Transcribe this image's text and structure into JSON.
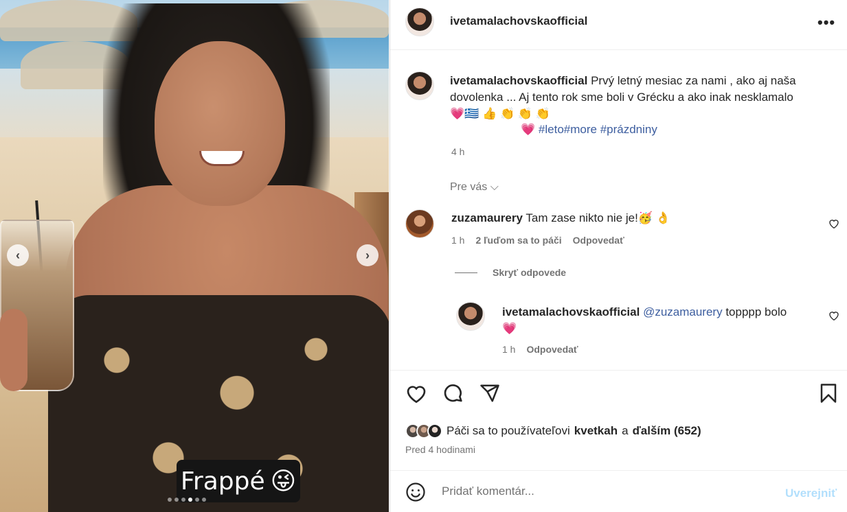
{
  "media": {
    "sticker_text": "Frappé",
    "sticker_emoji": "😜",
    "prev_label": "‹",
    "next_label": "›",
    "slide_count": 6,
    "active_slide": 4
  },
  "header": {
    "username": "ivetamalachovskaofficial",
    "more_label": "•••"
  },
  "caption": {
    "username": "ivetamalachovskaofficial",
    "text": "Prvý letný mesiac za nami , ako aj naša dovolenka ... Aj tento rok sme boli v Grécku a ako inak nesklamalo",
    "emojis": "💗🇬🇷 👍 👏 👏 👏",
    "heart": "💗",
    "hashtags": [
      "#leto",
      "#more",
      "#prázdniny"
    ],
    "time": "4 h"
  },
  "pre_vas": "Pre vás ⌵",
  "comments": [
    {
      "username": "zuzamaurery",
      "text": "Tam zase nikto nie je!🥳 👌",
      "time": "1 h",
      "likes": "2 ľuďom sa to páči",
      "reply_label": "Odpovedať"
    }
  ],
  "hide_replies_label": "Skryť odpovede",
  "reply": {
    "username": "ivetamalachovskaofficial",
    "mention": "@zuzamaurery",
    "text": "topppp bolo",
    "emoji": "💗",
    "time": "1 h",
    "reply_label": "Odpovedať"
  },
  "likes": {
    "prefix": "Páči sa to používateľovi",
    "user": "kvetkah",
    "middle": "a",
    "others": "ďalším (652)"
  },
  "ago": "Pred 4 hodinami",
  "comment_box": {
    "placeholder": "Pridať komentár...",
    "post_label": "Uverejniť"
  },
  "colors": {
    "link": "#3d5e9f",
    "muted": "#737373",
    "post_disabled": "#b2dffc",
    "heart": "#e0245e"
  }
}
